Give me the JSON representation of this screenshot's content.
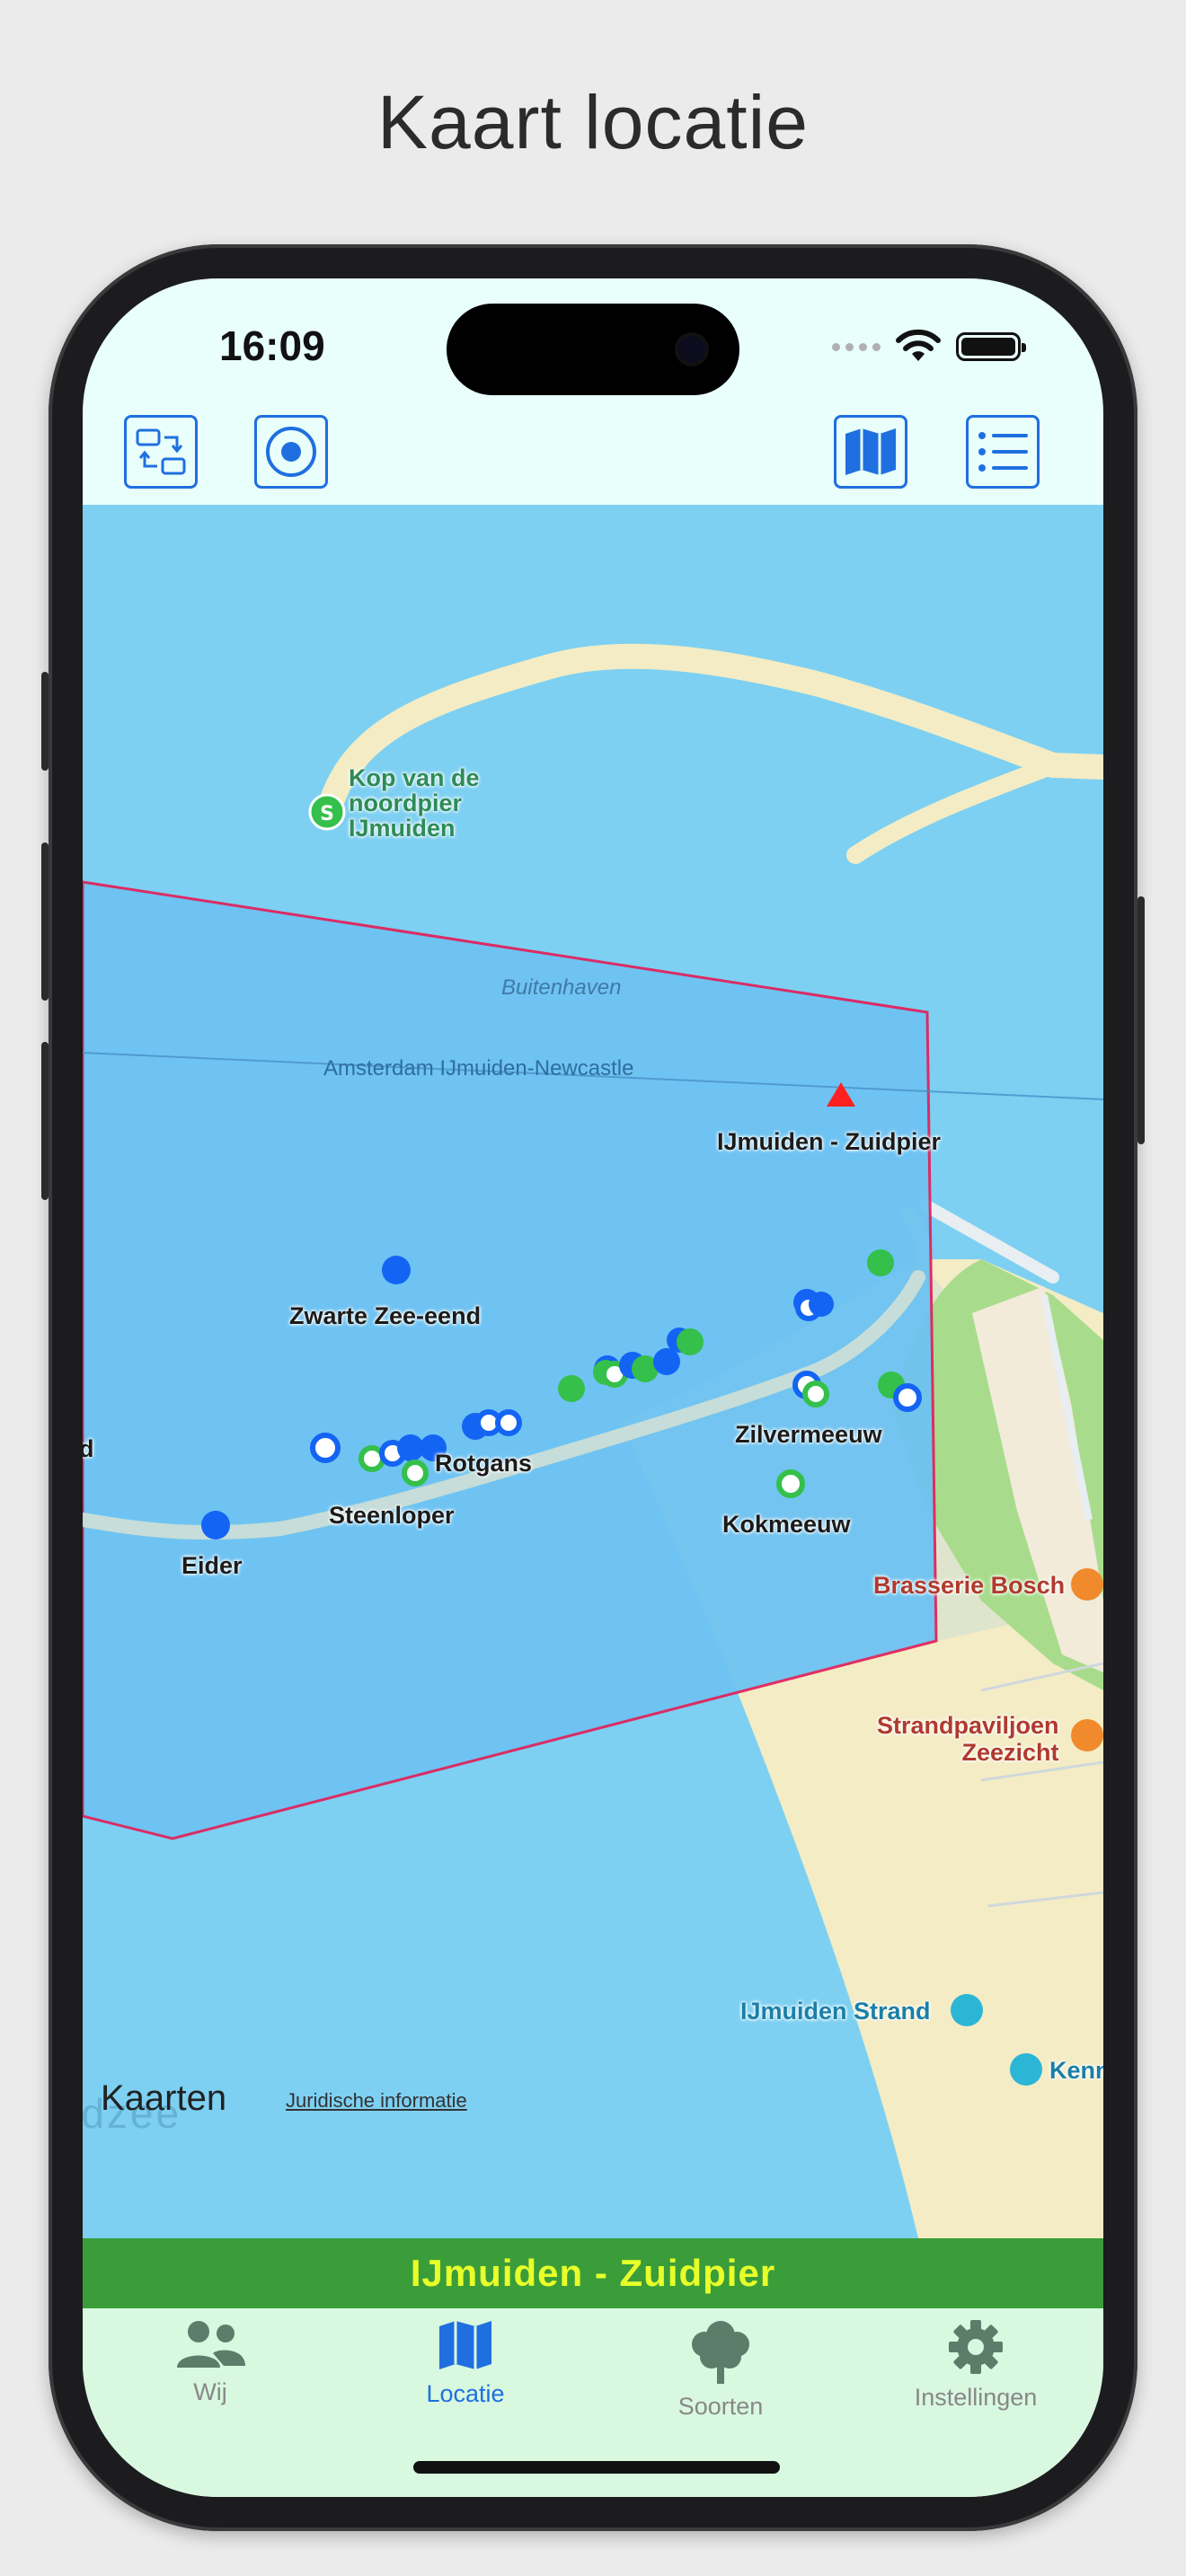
{
  "page_title": "Kaart locatie",
  "status_bar": {
    "time": "16:09"
  },
  "toolbar": {
    "buttons": [
      {
        "name": "switch-view",
        "icon": "switch-arrows-icon"
      },
      {
        "name": "locate",
        "icon": "target-icon"
      },
      {
        "name": "map-type",
        "icon": "map-icon"
      },
      {
        "name": "list",
        "icon": "list-icon"
      }
    ]
  },
  "map": {
    "labels": {
      "kop_noordpier": [
        "Kop van de",
        "noordpier",
        "IJmuiden"
      ],
      "buitenhaven": "Buitenhaven",
      "ferry_route": "Amsterdam IJmuiden-Newcastle",
      "zuidpier": "IJmuiden - Zuidpier",
      "zwarte_zee_eend": "Zwarte Zee-eend",
      "zilvermeeuw": "Zilvermeeuw",
      "rotgans": "Rotgans",
      "steenloper": "Steenloper",
      "kokmeeuw": "Kokmeeuw",
      "eider": "Eider",
      "edge_d": "d",
      "brasserie": "Brasserie Bosch",
      "strandpaviljoen": [
        "Strandpaviljoen",
        "Zeezicht"
      ],
      "ijmuiden_strand": "IJmuiden Strand",
      "kenn": "Kenn",
      "noordzee": "rdzee"
    },
    "attribution": {
      "brand": "Kaarten",
      "legal": "Juridische informatie"
    },
    "colors": {
      "water": "#7dd0f2",
      "region_fill": "#6ec3f2",
      "region_border": "#e0245e",
      "observation_blue": "#1464f4",
      "observation_green": "#34c04a",
      "marker_red": "#ff2020"
    }
  },
  "location_banner": "IJmuiden - Zuidpier",
  "tabs": [
    {
      "label": "Wij",
      "icon": "people-icon",
      "active": false
    },
    {
      "label": "Locatie",
      "icon": "map-icon",
      "active": true
    },
    {
      "label": "Soorten",
      "icon": "tree-icon",
      "active": false
    },
    {
      "label": "Instellingen",
      "icon": "gear-icon",
      "active": false
    }
  ]
}
